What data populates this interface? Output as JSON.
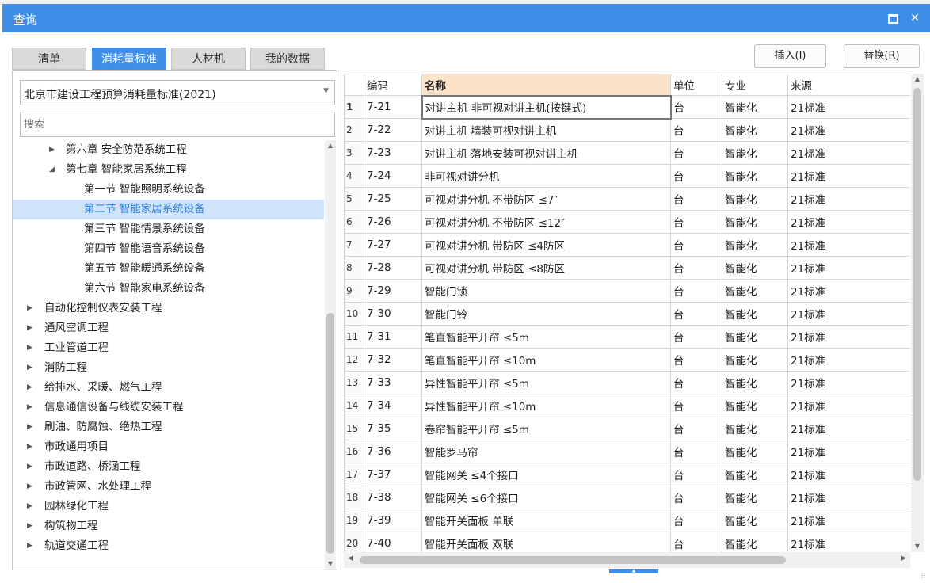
{
  "window": {
    "title": "查询",
    "maximize_label": "",
    "close_label": "✕"
  },
  "tabs": [
    "清单",
    "消耗量标准",
    "人材机",
    "我的数据"
  ],
  "active_tab": 1,
  "buttons": {
    "insert": "插入(I)",
    "replace": "替换(R)"
  },
  "library_select": {
    "value": "北京市建设工程预算消耗量标准(2021)"
  },
  "search": {
    "placeholder": "搜索"
  },
  "tree": [
    {
      "label": "第六章 安全防范系统工程",
      "level": 1,
      "toggle": "▶"
    },
    {
      "label": "第七章 智能家居系统工程",
      "level": 1,
      "toggle": "◢"
    },
    {
      "label": "第一节 智能照明系统设备",
      "level": 2
    },
    {
      "label": "第二节 智能家居系统设备",
      "level": 2,
      "selected": true
    },
    {
      "label": "第三节 智能情景系统设备",
      "level": 2
    },
    {
      "label": "第四节 智能语音系统设备",
      "level": 2
    },
    {
      "label": "第五节 智能暖通系统设备",
      "level": 2
    },
    {
      "label": "第六节 智能家电系统设备",
      "level": 2
    },
    {
      "label": "自动化控制仪表安装工程",
      "level": 0,
      "toggle": "▶"
    },
    {
      "label": "通风空调工程",
      "level": 0,
      "toggle": "▶"
    },
    {
      "label": "工业管道工程",
      "level": 0,
      "toggle": "▶"
    },
    {
      "label": "消防工程",
      "level": 0,
      "toggle": "▶"
    },
    {
      "label": "给排水、采暖、燃气工程",
      "level": 0,
      "toggle": "▶"
    },
    {
      "label": "信息通信设备与线缆安装工程",
      "level": 0,
      "toggle": "▶"
    },
    {
      "label": "刷油、防腐蚀、绝热工程",
      "level": 0,
      "toggle": "▶"
    },
    {
      "label": "市政通用项目",
      "level": 0,
      "toggle": "▶"
    },
    {
      "label": "市政道路、桥涵工程",
      "level": 0,
      "toggle": "▶"
    },
    {
      "label": "市政管网、水处理工程",
      "level": 0,
      "toggle": "▶"
    },
    {
      "label": "园林绿化工程",
      "level": 0,
      "toggle": "▶"
    },
    {
      "label": "构筑物工程",
      "level": 0,
      "toggle": "▶"
    },
    {
      "label": "轨道交通工程",
      "level": 0,
      "toggle": "▶"
    }
  ],
  "table": {
    "columns": [
      "",
      "编码",
      "名称",
      "单位",
      "专业",
      "来源"
    ],
    "current_row": 0,
    "rows": [
      [
        "1",
        "7-21",
        "对讲主机 非可视对讲主机(按键式)",
        "台",
        "智能化",
        "21标准"
      ],
      [
        "2",
        "7-22",
        "对讲主机 墙装可视对讲主机",
        "台",
        "智能化",
        "21标准"
      ],
      [
        "3",
        "7-23",
        "对讲主机 落地安装可视对讲主机",
        "台",
        "智能化",
        "21标准"
      ],
      [
        "4",
        "7-24",
        "非可视对讲分机",
        "台",
        "智能化",
        "21标准"
      ],
      [
        "5",
        "7-25",
        "可视对讲分机 不带防区 ≤7″",
        "台",
        "智能化",
        "21标准"
      ],
      [
        "6",
        "7-26",
        "可视对讲分机 不带防区 ≤12″",
        "台",
        "智能化",
        "21标准"
      ],
      [
        "7",
        "7-27",
        "可视对讲分机 带防区 ≤4防区",
        "台",
        "智能化",
        "21标准"
      ],
      [
        "8",
        "7-28",
        "可视对讲分机 带防区 ≤8防区",
        "台",
        "智能化",
        "21标准"
      ],
      [
        "9",
        "7-29",
        "智能门锁",
        "台",
        "智能化",
        "21标准"
      ],
      [
        "10",
        "7-30",
        "智能门铃",
        "台",
        "智能化",
        "21标准"
      ],
      [
        "11",
        "7-31",
        "笔直智能平开帘 ≤5m",
        "台",
        "智能化",
        "21标准"
      ],
      [
        "12",
        "7-32",
        "笔直智能平开帘 ≤10m",
        "台",
        "智能化",
        "21标准"
      ],
      [
        "13",
        "7-33",
        "异性智能平开帘 ≤5m",
        "台",
        "智能化",
        "21标准"
      ],
      [
        "14",
        "7-34",
        "异性智能平开帘 ≤10m",
        "台",
        "智能化",
        "21标准"
      ],
      [
        "15",
        "7-35",
        "卷帘智能平开帘 ≤5m",
        "台",
        "智能化",
        "21标准"
      ],
      [
        "16",
        "7-36",
        "智能罗马帘",
        "台",
        "智能化",
        "21标准"
      ],
      [
        "17",
        "7-37",
        "智能网关 ≤4个接口",
        "台",
        "智能化",
        "21标准"
      ],
      [
        "18",
        "7-38",
        "智能网关 ≤6个接口",
        "台",
        "智能化",
        "21标准"
      ],
      [
        "19",
        "7-39",
        "智能开关面板 单联",
        "台",
        "智能化",
        "21标准"
      ],
      [
        "20",
        "7-40",
        "智能开关面板 双联",
        "台",
        "智能化",
        "21标准"
      ]
    ]
  },
  "colors": {
    "accent": "#3f8ee8",
    "header_highlight": "#fce3c7",
    "selection": "#cfe4fb"
  }
}
